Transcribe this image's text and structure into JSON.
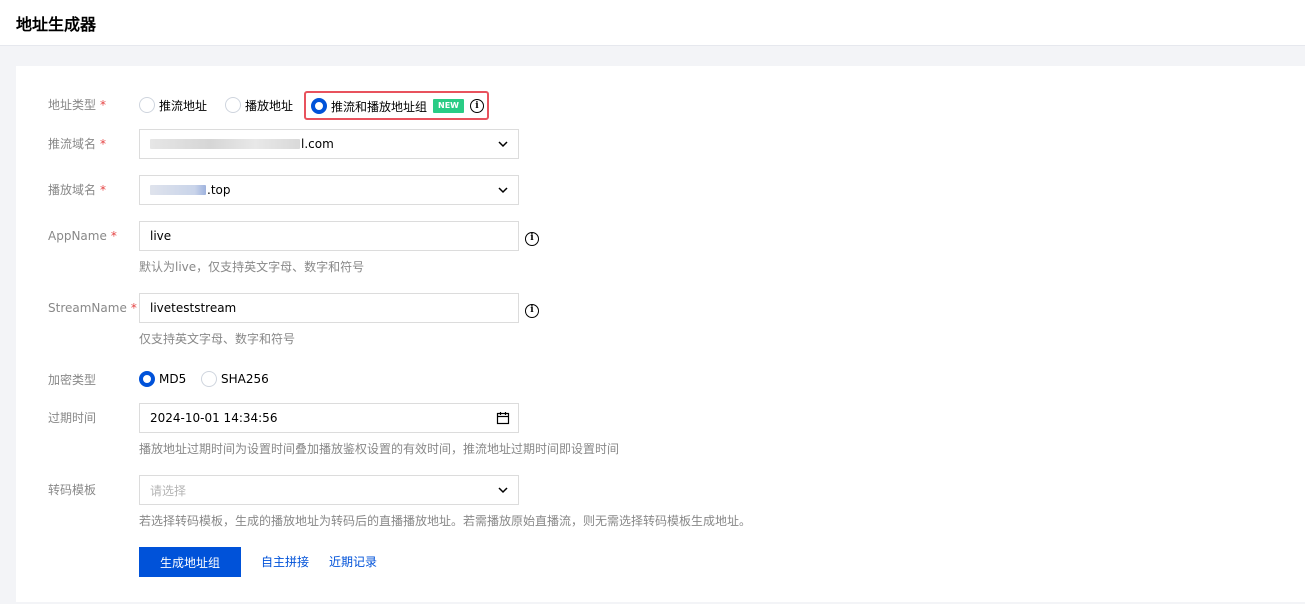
{
  "page": {
    "title": "地址生成器"
  },
  "form": {
    "address_type": {
      "label": "地址类型",
      "required_mark": "*",
      "options": [
        "推流地址",
        "播放地址",
        "推流和播放地址组"
      ],
      "selected": "推流和播放地址组",
      "new_badge": "NEW"
    },
    "push_domain": {
      "label": "推流域名",
      "required_mark": "*",
      "value_suffix": "l.com"
    },
    "play_domain": {
      "label": "播放域名",
      "required_mark": "*",
      "value_suffix": ".top"
    },
    "app_name": {
      "label": "AppName",
      "required_mark": "*",
      "value": "live",
      "hint": "默认为live，仅支持英文字母、数字和符号"
    },
    "stream_name": {
      "label": "StreamName",
      "required_mark": "*",
      "value": "liveteststream",
      "hint": "仅支持英文字母、数字和符号"
    },
    "encrypt_type": {
      "label": "加密类型",
      "options": [
        "MD5",
        "SHA256"
      ],
      "selected": "MD5"
    },
    "expire_time": {
      "label": "过期时间",
      "value": "2024-10-01 14:34:56",
      "hint": "播放地址过期时间为设置时间叠加播放鉴权设置的有效时间，推流地址过期时间即设置时间"
    },
    "transcode_template": {
      "label": "转码模板",
      "placeholder": "请选择",
      "hint": "若选择转码模板，生成的播放地址为转码后的直播播放地址。若需播放原始直播流，则无需选择转码模板生成地址。"
    }
  },
  "actions": {
    "generate_label": "生成地址组",
    "custom_label": "自主拼接",
    "history_label": "近期记录"
  },
  "colors": {
    "primary": "#0052d9",
    "highlight_border": "#e8525d",
    "new_badge": "#29cc85",
    "required": "#e54545"
  }
}
